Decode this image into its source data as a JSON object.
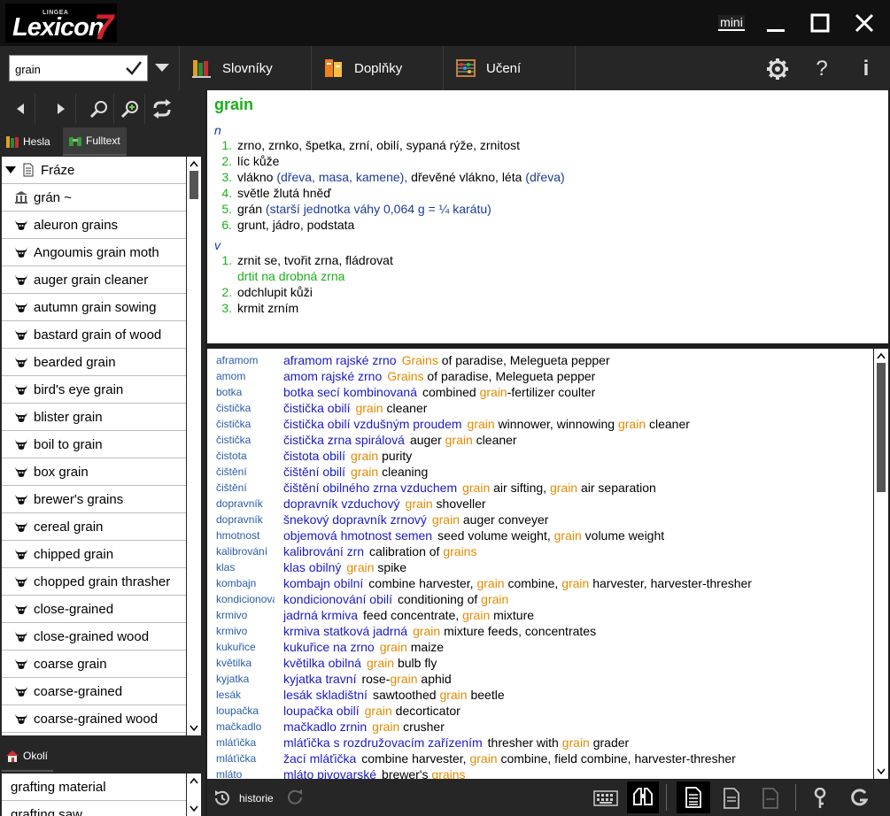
{
  "app": {
    "logo_small": "LINGEA",
    "logo_main": "Lexicon",
    "logo_version": "7",
    "mini_label": "mini"
  },
  "toolbar": {
    "search_value": "grain",
    "tabs": [
      {
        "label": "Slovníky",
        "icon": "books-icon"
      },
      {
        "label": "Doplňky",
        "icon": "addons-icon"
      },
      {
        "label": "Učení",
        "icon": "abacus-icon"
      }
    ]
  },
  "left": {
    "tab_hesla": "Hesla",
    "tab_fulltext": "Fulltext",
    "list_header": "Fráze",
    "items": [
      {
        "label": "grán ~",
        "icon": "bank-icon"
      },
      {
        "label": "aleuron grains",
        "icon": "bull-icon"
      },
      {
        "label": "Angoumis grain moth",
        "icon": "bull-icon"
      },
      {
        "label": "auger grain cleaner",
        "icon": "bull-icon"
      },
      {
        "label": "autumn grain sowing",
        "icon": "bull-icon"
      },
      {
        "label": "bastard grain of wood",
        "icon": "bull-icon"
      },
      {
        "label": "bearded grain",
        "icon": "bull-icon"
      },
      {
        "label": "bird's eye grain",
        "icon": "bull-icon"
      },
      {
        "label": "blister grain",
        "icon": "bull-icon"
      },
      {
        "label": "boil to grain",
        "icon": "bull-icon"
      },
      {
        "label": "box grain",
        "icon": "bull-icon"
      },
      {
        "label": "brewer's grains",
        "icon": "bull-icon"
      },
      {
        "label": "cereal grain",
        "icon": "bull-icon"
      },
      {
        "label": "chipped grain",
        "icon": "bull-icon"
      },
      {
        "label": "chopped grain thrasher",
        "icon": "bull-icon"
      },
      {
        "label": "close-grained",
        "icon": "bull-icon"
      },
      {
        "label": "close-grained wood",
        "icon": "bull-icon"
      },
      {
        "label": "coarse grain",
        "icon": "bull-icon"
      },
      {
        "label": "coarse-grained",
        "icon": "bull-icon"
      },
      {
        "label": "coarse-grained wood",
        "icon": "bull-icon"
      }
    ],
    "okoli_label": "Okolí",
    "okoli_items": [
      "grafting material",
      "grafting saw"
    ]
  },
  "entry": {
    "headword": "grain",
    "noun_pos": "n",
    "noun_senses": [
      {
        "num": "1.",
        "text": "zrno, zrnko, špetka, zrní, obilí, sypaná rýže, zrnitost",
        "note": "",
        "text2": "",
        "note2": ""
      },
      {
        "num": "2.",
        "text": "líc kůže",
        "note": "",
        "text2": "",
        "note2": ""
      },
      {
        "num": "3.",
        "text": "vlákno",
        "note": "(dřeva, masa, kamene),",
        "text2": "dřevěné vlákno, léta",
        "note2": "(dřeva)"
      },
      {
        "num": "4.",
        "text": "světle žlutá hněď",
        "note": "",
        "text2": "",
        "note2": ""
      },
      {
        "num": "5.",
        "text": "grán",
        "note": "(starší jednotka váhy 0,064 g = ¼ karátu)",
        "text2": "",
        "note2": ""
      },
      {
        "num": "6.",
        "text": "grunt, jádro, podstata",
        "note": "",
        "text2": "",
        "note2": ""
      }
    ],
    "verb_pos": "v",
    "verb_senses": [
      {
        "num": "1.",
        "text": "zrnit se, tvořit zrna, fládrovat"
      },
      {
        "num": "2.",
        "text": "odchlupit kůži"
      },
      {
        "num": "3.",
        "text": "krmit zrním"
      }
    ],
    "verb_sub": "drtit na drobná zrna"
  },
  "fulltext": [
    {
      "key": "aframom",
      "head": "aframom rajské zrno",
      "pre": "",
      "hl": "Grains",
      "post": " of paradise, Melegueta pepper"
    },
    {
      "key": "amom",
      "head": "amom rajské zrno",
      "pre": "",
      "hl": "Grains",
      "post": " of paradise, Melegueta pepper"
    },
    {
      "key": "botka",
      "head": "botka secí kombinovaná",
      "pre": "combined ",
      "hl": "grain",
      "post": "-fertilizer coulter"
    },
    {
      "key": "čistička",
      "head": "čistička obilí",
      "pre": "",
      "hl": "grain",
      "post": " cleaner"
    },
    {
      "key": "čistička",
      "head": "čistička obilí vzdušným proudem",
      "pre": "",
      "hl": "grain",
      "post": " winnower, winnowing ",
      "hl2": "grain",
      "post2": " cleaner"
    },
    {
      "key": "čistička",
      "head": "čistička zrna spirálová",
      "pre": "auger ",
      "hl": "grain",
      "post": " cleaner"
    },
    {
      "key": "čistota",
      "head": "čistota obilí",
      "pre": "",
      "hl": "grain",
      "post": " purity"
    },
    {
      "key": "čištění",
      "head": "čištění obilí",
      "pre": "",
      "hl": "grain",
      "post": " cleaning"
    },
    {
      "key": "čištění",
      "head": "čištění obilného zrna vzduchem",
      "pre": "",
      "hl": "grain",
      "post": " air sifting, ",
      "hl2": "grain",
      "post2": " air separation"
    },
    {
      "key": "dopravník",
      "head": "dopravník vzduchový",
      "pre": "",
      "hl": "grain",
      "post": " shoveller"
    },
    {
      "key": "dopravník",
      "head": "šnekový dopravník zrnový",
      "pre": "",
      "hl": "grain",
      "post": " auger conveyer"
    },
    {
      "key": "hmotnost",
      "head": "objemová hmotnost semen",
      "pre": "seed volume weight, ",
      "hl": "grain",
      "post": " volume weight"
    },
    {
      "key": "kalibrování",
      "head": "kalibrování zrn",
      "pre": "calibration of ",
      "hl": "grains",
      "post": ""
    },
    {
      "key": "klas",
      "head": "klas obilný",
      "pre": "",
      "hl": "grain",
      "post": " spike"
    },
    {
      "key": "kombajn",
      "head": "kombajn obilní",
      "pre": "combine harvester, ",
      "hl": "grain",
      "post": " combine, ",
      "hl2": "grain",
      "post2": " harvester, harvester-thresher"
    },
    {
      "key": "kondicionování",
      "head": "kondicionování obilí",
      "pre": "conditioning of ",
      "hl": "grain",
      "post": ""
    },
    {
      "key": "krmivo",
      "head": "jadrná krmiva",
      "pre": "feed concentrate, ",
      "hl": "grain",
      "post": " mixture"
    },
    {
      "key": "krmivo",
      "head": "krmiva statková jadrná",
      "pre": "",
      "hl": "grain",
      "post": " mixture feeds, concentrates"
    },
    {
      "key": "kukuřice",
      "head": "kukuřice na zrno",
      "pre": "",
      "hl": "grain",
      "post": " maize"
    },
    {
      "key": "květilka",
      "head": "květilka obilná",
      "pre": "",
      "hl": "grain",
      "post": " bulb fly"
    },
    {
      "key": "kyjatka",
      "head": "kyjatka travní",
      "pre": "rose-",
      "hl": "grain",
      "post": " aphid"
    },
    {
      "key": "lesák",
      "head": "lesák skladištní",
      "pre": "sawtoothed ",
      "hl": "grain",
      "post": " beetle"
    },
    {
      "key": "loupačka",
      "head": "loupačka obilí",
      "pre": "",
      "hl": "grain",
      "post": " decorticator"
    },
    {
      "key": "mačkadlo",
      "head": "mačkadlo zrnin",
      "pre": "",
      "hl": "grain",
      "post": " crusher"
    },
    {
      "key": "mláťička",
      "head": "mláťička s rozdružovacím zařízením",
      "pre": "thresher with ",
      "hl": "grain",
      "post": " grader"
    },
    {
      "key": "mláťička",
      "head": "žací mláťička",
      "pre": "combine harvester, ",
      "hl": "grain",
      "post": " combine, field combine, harvester-thresher"
    },
    {
      "key": "mláto",
      "head": "mláto pivovarské",
      "pre": "brewer's ",
      "hl": "grains",
      "post": ""
    }
  ],
  "bottom": {
    "history_label": "historie"
  },
  "colors": {
    "accent_green": "#1ab01a",
    "link_blue": "#1a1acc",
    "highlight_orange": "#e68a00",
    "brand_red": "#d4202a"
  }
}
